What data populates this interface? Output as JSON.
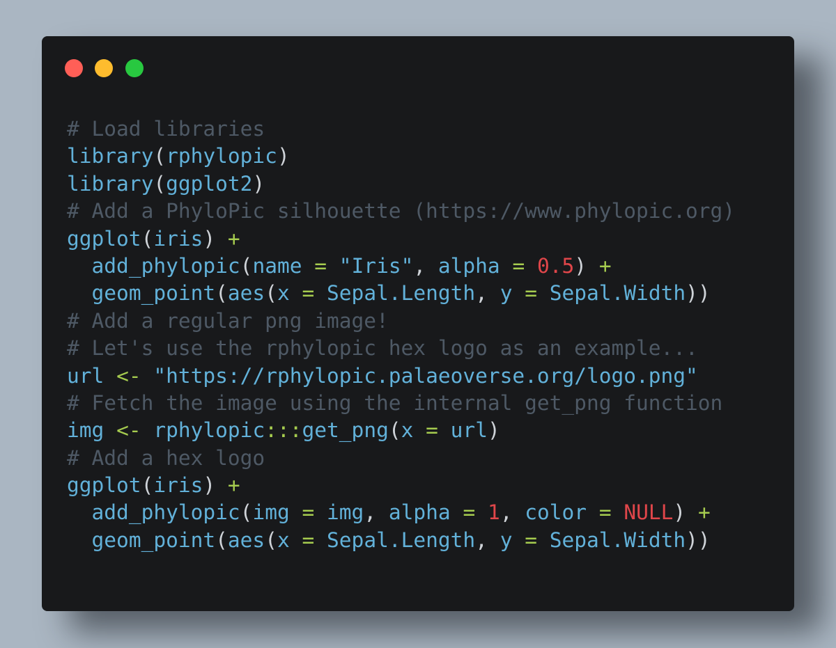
{
  "window": {
    "buttons": {
      "close_color": "#ff5f57",
      "minimize_color": "#febc2e",
      "maximize_color": "#28c840"
    }
  },
  "code": {
    "language": "r",
    "lines": [
      [
        [
          "comment",
          "# Load libraries"
        ]
      ],
      [
        [
          "fn",
          "library"
        ],
        [
          "plain",
          "("
        ],
        [
          "id",
          "rphylopic"
        ],
        [
          "plain",
          ")"
        ]
      ],
      [
        [
          "fn",
          "library"
        ],
        [
          "plain",
          "("
        ],
        [
          "id",
          "ggplot2"
        ],
        [
          "plain",
          ")"
        ]
      ],
      [
        [
          "comment",
          "# Add a PhyloPic silhouette (https://www.phylopic.org)"
        ]
      ],
      [
        [
          "fn",
          "ggplot"
        ],
        [
          "plain",
          "("
        ],
        [
          "id",
          "iris"
        ],
        [
          "plain",
          ") "
        ],
        [
          "op",
          "+"
        ]
      ],
      [
        [
          "plain",
          "  "
        ],
        [
          "fn",
          "add_phylopic"
        ],
        [
          "plain",
          "("
        ],
        [
          "id",
          "name"
        ],
        [
          "plain",
          " "
        ],
        [
          "op",
          "="
        ],
        [
          "plain",
          " "
        ],
        [
          "str",
          "\"Iris\""
        ],
        [
          "plain",
          ", "
        ],
        [
          "id",
          "alpha"
        ],
        [
          "plain",
          " "
        ],
        [
          "op",
          "="
        ],
        [
          "plain",
          " "
        ],
        [
          "num",
          "0.5"
        ],
        [
          "plain",
          ") "
        ],
        [
          "op",
          "+"
        ]
      ],
      [
        [
          "plain",
          "  "
        ],
        [
          "fn",
          "geom_point"
        ],
        [
          "plain",
          "("
        ],
        [
          "fn",
          "aes"
        ],
        [
          "plain",
          "("
        ],
        [
          "id",
          "x"
        ],
        [
          "plain",
          " "
        ],
        [
          "op",
          "="
        ],
        [
          "plain",
          " "
        ],
        [
          "id",
          "Sepal.Length"
        ],
        [
          "plain",
          ", "
        ],
        [
          "id",
          "y"
        ],
        [
          "plain",
          " "
        ],
        [
          "op",
          "="
        ],
        [
          "plain",
          " "
        ],
        [
          "id",
          "Sepal.Width"
        ],
        [
          "plain",
          "))"
        ]
      ],
      [
        [
          "comment",
          "# Add a regular png image!"
        ]
      ],
      [
        [
          "comment",
          "# Let's use the rphylopic hex logo as an example..."
        ]
      ],
      [
        [
          "id",
          "url"
        ],
        [
          "plain",
          " "
        ],
        [
          "op",
          "<-"
        ],
        [
          "plain",
          " "
        ],
        [
          "str",
          "\"https://rphylopic.palaeoverse.org/logo.png\""
        ]
      ],
      [
        [
          "comment",
          "# Fetch the image using the internal get_png function"
        ]
      ],
      [
        [
          "id",
          "img"
        ],
        [
          "plain",
          " "
        ],
        [
          "op",
          "<-"
        ],
        [
          "plain",
          " "
        ],
        [
          "id",
          "rphylopic"
        ],
        [
          "op",
          ":::"
        ],
        [
          "fn",
          "get_png"
        ],
        [
          "plain",
          "("
        ],
        [
          "id",
          "x"
        ],
        [
          "plain",
          " "
        ],
        [
          "op",
          "="
        ],
        [
          "plain",
          " "
        ],
        [
          "id",
          "url"
        ],
        [
          "plain",
          ")"
        ]
      ],
      [
        [
          "comment",
          "# Add a hex logo"
        ]
      ],
      [
        [
          "fn",
          "ggplot"
        ],
        [
          "plain",
          "("
        ],
        [
          "id",
          "iris"
        ],
        [
          "plain",
          ") "
        ],
        [
          "op",
          "+"
        ]
      ],
      [
        [
          "plain",
          "  "
        ],
        [
          "fn",
          "add_phylopic"
        ],
        [
          "plain",
          "("
        ],
        [
          "id",
          "img"
        ],
        [
          "plain",
          " "
        ],
        [
          "op",
          "="
        ],
        [
          "plain",
          " "
        ],
        [
          "id",
          "img"
        ],
        [
          "plain",
          ", "
        ],
        [
          "id",
          "alpha"
        ],
        [
          "plain",
          " "
        ],
        [
          "op",
          "="
        ],
        [
          "plain",
          " "
        ],
        [
          "num",
          "1"
        ],
        [
          "plain",
          ", "
        ],
        [
          "id",
          "color"
        ],
        [
          "plain",
          " "
        ],
        [
          "op",
          "="
        ],
        [
          "plain",
          " "
        ],
        [
          "num",
          "NULL"
        ],
        [
          "plain",
          ") "
        ],
        [
          "op",
          "+"
        ]
      ],
      [
        [
          "plain",
          "  "
        ],
        [
          "fn",
          "geom_point"
        ],
        [
          "plain",
          "("
        ],
        [
          "fn",
          "aes"
        ],
        [
          "plain",
          "("
        ],
        [
          "id",
          "x"
        ],
        [
          "plain",
          " "
        ],
        [
          "op",
          "="
        ],
        [
          "plain",
          " "
        ],
        [
          "id",
          "Sepal.Length"
        ],
        [
          "plain",
          ", "
        ],
        [
          "id",
          "y"
        ],
        [
          "plain",
          " "
        ],
        [
          "op",
          "="
        ],
        [
          "plain",
          " "
        ],
        [
          "id",
          "Sepal.Width"
        ],
        [
          "plain",
          "))"
        ]
      ]
    ]
  }
}
